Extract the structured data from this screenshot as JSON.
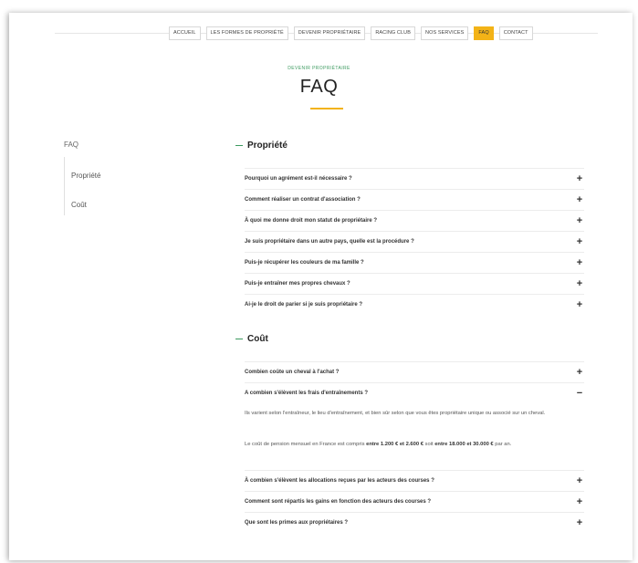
{
  "nav": {
    "items": [
      {
        "label": "ACCUEIL",
        "active": false
      },
      {
        "label": "LES FORMES DE PROPRIÉTÉ",
        "active": false
      },
      {
        "label": "DEVENIR PROPRIÉTAIRE",
        "active": false
      },
      {
        "label": "RACING CLUB",
        "active": false
      },
      {
        "label": "NOS SERVICES",
        "active": false
      },
      {
        "label": "FAQ",
        "active": true
      },
      {
        "label": "CONTACT",
        "active": false
      }
    ]
  },
  "header": {
    "eyebrow": "DEVENIR PROPRIÉTAIRE",
    "title": "FAQ"
  },
  "sidebar": {
    "top": "FAQ",
    "items": [
      "Propriété",
      "Coût"
    ]
  },
  "sections": [
    {
      "title": "Propriété",
      "questions": [
        "Pourquoi un agrément est-il nécessaire ?",
        "Comment réaliser un contrat d'association ?",
        "À quoi me donne droit mon statut de propriétaire ?",
        "Je suis propriétaire dans un autre pays, quelle est la procédure ?",
        "Puis-je récupérer les couleurs de ma famille ?",
        "Puis-je entraîner mes propres chevaux ?",
        "Ai-je le droit de parier si je suis propriétaire ?"
      ]
    },
    {
      "title": "Coût",
      "questions": [
        "Combien coûte un cheval à l'achat ?",
        "A combien s'élèvent les frais d'entraînements ?",
        "À combien s'élèvent les allocations reçues par les acteurs des courses ?",
        "Comment sont répartis les gains en fonction des acteurs des courses ?",
        "Que sont les primes aux propriétaires ?"
      ],
      "expanded_answer": {
        "p1": "Ils varient selon l'entraîneur, le lieu d'entraînement, et bien sûr selon que vous êtes propriétaire unique ou associé sur un cheval.",
        "p2_a": "Le coût de pension mensuel en France est compris ",
        "p2_b": "entre 1.200 € et 2.600 €",
        "p2_c": " soit ",
        "p2_d": "entre 18.000 et 30.000 €",
        "p2_e": " par an."
      }
    }
  ],
  "icons": {
    "collapsed": "plus-icon",
    "expanded": "minus-icon"
  },
  "colors": {
    "accent": "#f3b317",
    "green": "#3c9a5f"
  }
}
